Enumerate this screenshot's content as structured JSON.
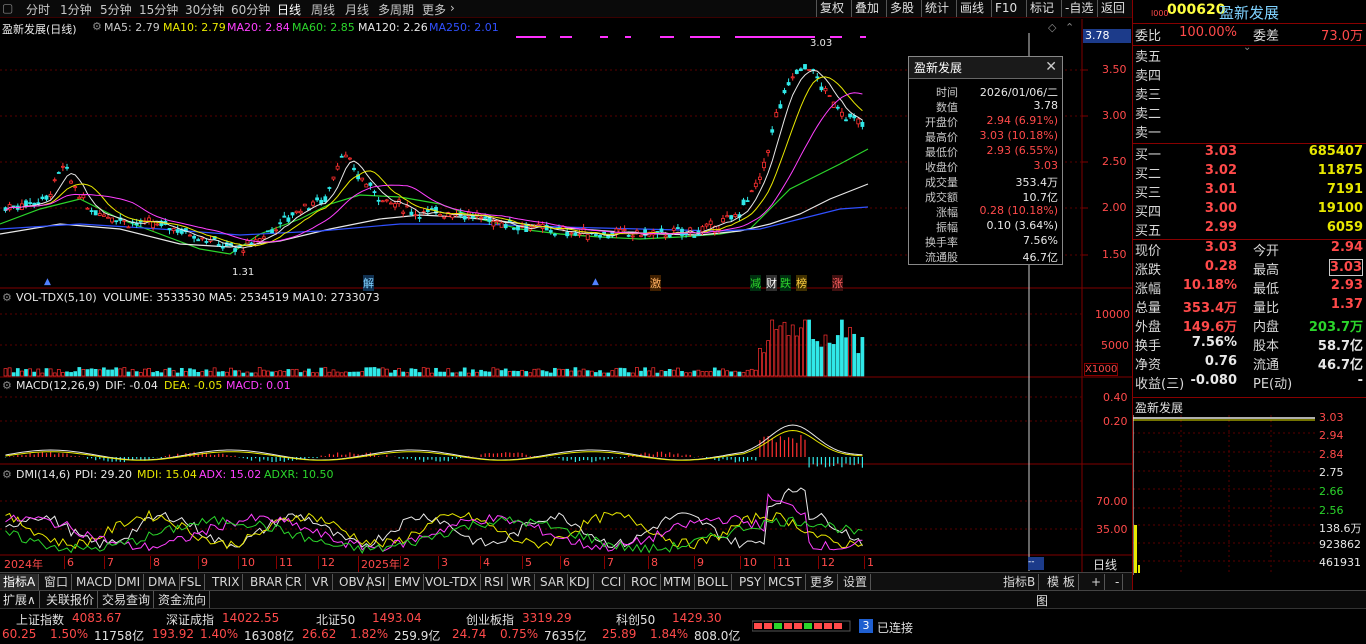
{
  "toolbar": {
    "periods": [
      "分时",
      "1分钟",
      "5分钟",
      "15分钟",
      "30分钟",
      "60分钟",
      "日线",
      "周线",
      "月线",
      "多周期",
      "更多"
    ],
    "active_period": "日线",
    "buttons": [
      "复权",
      "叠加",
      "多股",
      "统计",
      "画线",
      "F10",
      "标记",
      "-自选",
      "返回"
    ]
  },
  "main_chart": {
    "title": "盈新发展(日线)",
    "ma_labels": [
      {
        "text": "MA5: 2.79",
        "color": "#e8e8e8"
      },
      {
        "text": "MA10: 2.79",
        "color": "#e8e800"
      },
      {
        "text": "MA20: 2.84",
        "color": "#ff40ff"
      },
      {
        "text": "MA60: 2.85",
        "color": "#2bd52b"
      },
      {
        "text": "MA120: 2.26",
        "color": "#e8e8e8"
      },
      {
        "text": "MA250: 2.01",
        "color": "#3050ff"
      }
    ],
    "price_axis": [
      "3.50",
      "3.00",
      "2.50",
      "2.00",
      "1.50"
    ],
    "current_price_tag": "3.78",
    "high_label": "3.03",
    "low_label": "1.31",
    "event_tags": [
      "解",
      "激",
      "减",
      "财",
      "跌",
      "榜",
      "涨"
    ]
  },
  "volume_chart": {
    "title": "VOL-TDX(5,10)",
    "values": "VOLUME: 3533530  MA5: 2534519  MA10: 2733073",
    "axis": [
      "10000",
      "5000"
    ],
    "unit": "X1000"
  },
  "macd_chart": {
    "title": "MACD(12,26,9)",
    "dif": "DIF: -0.04",
    "dea": "DEA: -0.05",
    "macd": "MACD: 0.01",
    "axis": [
      "0.40",
      "0.20"
    ]
  },
  "dmi_chart": {
    "title": "DMI(14,6)",
    "pdi": "PDI: 29.20",
    "mdi": "MDI: 15.04",
    "adx": "ADX: 15.02",
    "adxr": "ADXR: 10.50",
    "axis": [
      "70.00",
      "35.00"
    ]
  },
  "time_axis": {
    "labels": [
      "2024年",
      "6",
      "7",
      "8",
      "9",
      "10",
      "11",
      "12",
      "2025年",
      "2",
      "3",
      "4",
      "5",
      "6",
      "7",
      "8",
      "9",
      "10",
      "11",
      "12",
      "1"
    ],
    "period_label": "日线"
  },
  "popup": {
    "title": "盈新发展",
    "rows": [
      {
        "k": "时间",
        "v": "2026/01/06/二",
        "c": "#e8e8e8"
      },
      {
        "k": "数值",
        "v": "3.78",
        "c": "#e8e8e8"
      },
      {
        "k": "开盘价",
        "v": "2.94 (6.91%)",
        "c": "#ff4a4a"
      },
      {
        "k": "最高价",
        "v": "3.03 (10.18%)",
        "c": "#ff4a4a"
      },
      {
        "k": "最低价",
        "v": "2.93 (6.55%)",
        "c": "#ff4a4a"
      },
      {
        "k": "收盘价",
        "v": "3.03",
        "c": "#ff4a4a"
      },
      {
        "k": "成交量",
        "v": "353.4万",
        "c": "#e8e8e8"
      },
      {
        "k": "成交额",
        "v": "10.7亿",
        "c": "#e8e8e8"
      },
      {
        "k": "涨幅",
        "v": "0.28 (10.18%)",
        "c": "#ff4a4a"
      },
      {
        "k": "振幅",
        "v": "0.10 (3.64%)",
        "c": "#e8e8e8"
      },
      {
        "k": "换手率",
        "v": "7.56%",
        "c": "#e8e8e8"
      },
      {
        "k": "流通股",
        "v": "46.7亿",
        "c": "#e8e8e8"
      }
    ]
  },
  "quote": {
    "code": "000620",
    "name": "盈新发展",
    "weibi_label": "委比",
    "weibi": "100.00%",
    "weicha_label": "委差",
    "weicha": "73.0万",
    "sell": [
      {
        "label": "卖五",
        "price": "",
        "vol": ""
      },
      {
        "label": "卖四",
        "price": "",
        "vol": ""
      },
      {
        "label": "卖三",
        "price": "",
        "vol": ""
      },
      {
        "label": "卖二",
        "price": "",
        "vol": ""
      },
      {
        "label": "卖一",
        "price": "",
        "vol": ""
      }
    ],
    "buy": [
      {
        "label": "买一",
        "price": "3.03",
        "vol": "685407"
      },
      {
        "label": "买二",
        "price": "3.02",
        "vol": "11875"
      },
      {
        "label": "买三",
        "price": "3.01",
        "vol": "7191"
      },
      {
        "label": "买四",
        "price": "3.00",
        "vol": "19100"
      },
      {
        "label": "买五",
        "price": "2.99",
        "vol": "6059"
      }
    ],
    "stats": [
      {
        "l1": "现价",
        "v1": "3.03",
        "c1": "#ff4a4a",
        "l2": "今开",
        "v2": "2.94",
        "c2": "#ff4a4a"
      },
      {
        "l1": "涨跌",
        "v1": "0.28",
        "c1": "#ff4a4a",
        "l2": "最高",
        "v2": "3.03",
        "c2": "#ff4a4a"
      },
      {
        "l1": "涨幅",
        "v1": "10.18%",
        "c1": "#ff4a4a",
        "l2": "最低",
        "v2": "2.93",
        "c2": "#ff4a4a"
      },
      {
        "l1": "总量",
        "v1": "353.4万",
        "c1": "#ff4a4a",
        "l2": "量比",
        "v2": "1.37",
        "c2": "#ff4a4a"
      },
      {
        "l1": "外盘",
        "v1": "149.6万",
        "c1": "#ff4a4a",
        "l2": "内盘",
        "v2": "203.7万",
        "c2": "#2bd52b"
      },
      {
        "l1": "换手",
        "v1": "7.56%",
        "c1": "#e8e8e8",
        "l2": "股本",
        "v2": "58.7亿",
        "c2": "#e8e8e8"
      },
      {
        "l1": "净资",
        "v1": "0.76",
        "c1": "#e8e8e8",
        "l2": "流通",
        "v2": "46.7亿",
        "c2": "#e8e8e8"
      },
      {
        "l1": "收益(三)",
        "v1": "-0.080",
        "c1": "#e8e8e8",
        "l2": "PE(动)",
        "v2": "-",
        "c2": "#e8e8e8"
      }
    ],
    "mini_title": "盈新发展",
    "mini_axis": [
      {
        "v": "3.03",
        "c": "#ff4a4a"
      },
      {
        "v": "2.94",
        "c": "#ff4a4a"
      },
      {
        "v": "2.84",
        "c": "#ff4a4a"
      },
      {
        "v": "2.75",
        "c": "#e8e8e8"
      },
      {
        "v": "2.66",
        "c": "#2bd52b"
      },
      {
        "v": "2.56",
        "c": "#2bd52b"
      },
      {
        "v": "138.6万",
        "c": "#e8e8e8"
      },
      {
        "v": "923862",
        "c": "#e8e8e8"
      },
      {
        "v": "461931",
        "c": "#e8e8e8"
      }
    ]
  },
  "indicator_tabs": [
    "指标A",
    "窗口",
    "MACD",
    "DMI",
    "DMA",
    "FSL",
    "TRIX",
    "BRAR",
    "CR",
    "VR",
    "OBV",
    "ASI",
    "EMV",
    "VOL-TDX",
    "RSI",
    "WR",
    "SAR",
    "KDJ",
    "CCI",
    "ROC",
    "MTM",
    "BOLL",
    "PSY",
    "MCST",
    "更多",
    "设置"
  ],
  "indicator_right": [
    "指标B",
    "模 板",
    "+",
    "-"
  ],
  "bottom_tabs": [
    "扩展∧",
    "关联报价",
    "交易查询",
    "资金流向"
  ],
  "ticker": [
    {
      "name": "上证指数",
      "val": "4083.67",
      "chg": "60.25",
      "pct": "1.50%",
      "amt": "11758亿"
    },
    {
      "name": "深证成指",
      "val": "14022.55",
      "chg": "193.92",
      "pct": "1.40%",
      "amt": "16308亿"
    },
    {
      "name": "北证50",
      "val": "1493.04",
      "chg": "26.62",
      "pct": "1.82%",
      "amt": "259.9亿"
    },
    {
      "name": "创业板指",
      "val": "3319.29",
      "chg": "24.74",
      "pct": "0.75%",
      "amt": "7635亿"
    },
    {
      "name": "科创50",
      "val": "1429.30",
      "chg": "25.89",
      "pct": "1.84%",
      "amt": "808.0亿"
    }
  ],
  "status": {
    "badge": "3",
    "text": "已连接",
    "side_label": "图"
  }
}
